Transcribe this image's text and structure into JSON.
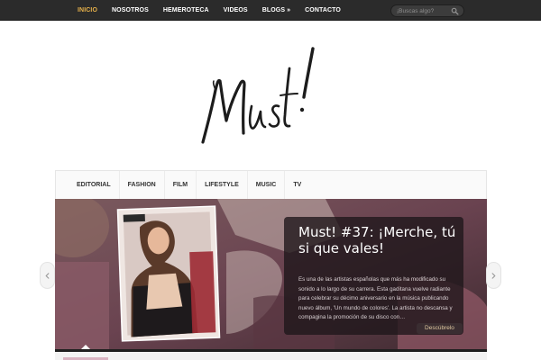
{
  "topnav": {
    "items": [
      {
        "label": "INICIO",
        "active": true
      },
      {
        "label": "NOSOTROS",
        "active": false
      },
      {
        "label": "HEMEROTECA",
        "active": false
      },
      {
        "label": "VIDEOS",
        "active": false
      },
      {
        "label": "BLOGS »",
        "active": false
      },
      {
        "label": "CONTACTO",
        "active": false
      }
    ],
    "active_color": "#e5b04a"
  },
  "search": {
    "placeholder": "¡Buscas algo?",
    "icon": "search-icon"
  },
  "logo": {
    "text": "Must!"
  },
  "categories": {
    "items": [
      "EDITORIAL",
      "FASHION",
      "FILM",
      "LIFESTYLE",
      "MUSIC",
      "TV"
    ]
  },
  "slider": {
    "title": "Must! #37: ¡Merche, tú si que vales!",
    "excerpt": "Es una de las artistas españolas que más ha modificado su sonido a lo largo de su carrera. Esta gaditana vuelve radiante para celebrar su décimo aniversario en la música publicando nuevo álbum, 'Un mundo de colores'. La artista no descansa y compagina la promoción de su disco con…",
    "more_label": "Descúbrelo",
    "prev_icon": "chevron-left-icon",
    "next_icon": "chevron-right-icon"
  }
}
